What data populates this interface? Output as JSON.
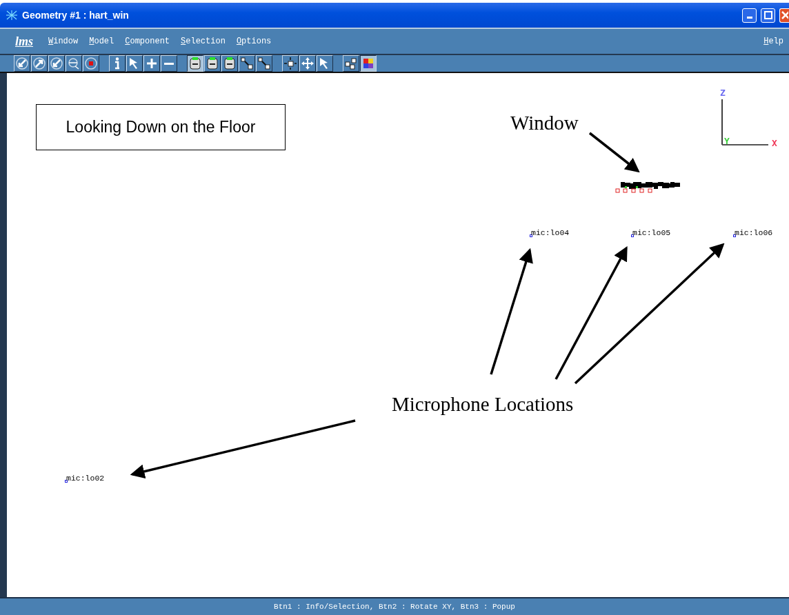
{
  "window": {
    "title": "Geometry #1 : hart_win"
  },
  "menu": [
    {
      "label": "lms",
      "kind": "logo"
    },
    {
      "label": "Window",
      "kind": "menu",
      "underline_first": true
    },
    {
      "label": "Model",
      "kind": "menu",
      "underline_first": true
    },
    {
      "label": "Component",
      "kind": "menu",
      "underline_first": true
    },
    {
      "label": "Selection",
      "kind": "menu",
      "underline_first": true
    },
    {
      "label": "Options",
      "kind": "menu",
      "underline_first": true
    },
    {
      "label": "Help",
      "kind": "help",
      "underline_first": true
    }
  ],
  "toolbar_groups": [
    {
      "buttons": [
        {
          "kind": "circle-arrow-sw",
          "selected": false
        },
        {
          "kind": "circle-arrow-ne",
          "selected": false
        },
        {
          "kind": "circle-arrow-sw",
          "selected": false
        },
        {
          "kind": "frame",
          "selected": false
        },
        {
          "kind": "record",
          "selected": false
        }
      ]
    },
    {
      "buttons": [
        {
          "kind": "info",
          "selected": false
        },
        {
          "kind": "pointer",
          "selected": false
        },
        {
          "kind": "plus",
          "selected": false
        },
        {
          "kind": "minus",
          "selected": false
        }
      ]
    },
    {
      "buttons": [
        {
          "kind": "mouse",
          "selected": true
        },
        {
          "kind": "mouse",
          "selected": false
        },
        {
          "kind": "mouse",
          "selected": false
        },
        {
          "kind": "cube-arrow",
          "selected": false
        },
        {
          "kind": "cube-arrow",
          "selected": false
        }
      ]
    },
    {
      "buttons": [
        {
          "kind": "cube-expand",
          "selected": false
        },
        {
          "kind": "move",
          "selected": false
        },
        {
          "kind": "pointer",
          "selected": false
        }
      ]
    },
    {
      "buttons": [
        {
          "kind": "cubes",
          "selected": false
        },
        {
          "kind": "color-cube",
          "selected": true
        }
      ]
    }
  ],
  "canvas": {
    "caption": "Looking Down on the Floor",
    "annotations": [
      {
        "text": "Window"
      },
      {
        "text": "Microphone Locations"
      }
    ],
    "points": [
      {
        "label": "mic:lo04"
      },
      {
        "label": "mic:lo05"
      },
      {
        "label": "mic:lo06"
      },
      {
        "label": "mic:lo02"
      }
    ],
    "axes": [
      {
        "label": "Z",
        "color": "#6a6af0"
      },
      {
        "label": "Y",
        "color": "#40d040"
      },
      {
        "label": "X",
        "color": "#f03a5a"
      }
    ]
  },
  "status_bar": {
    "text": "Btn1 : Info/Selection, Btn2 : Rotate XY, Btn3 : Popup"
  }
}
